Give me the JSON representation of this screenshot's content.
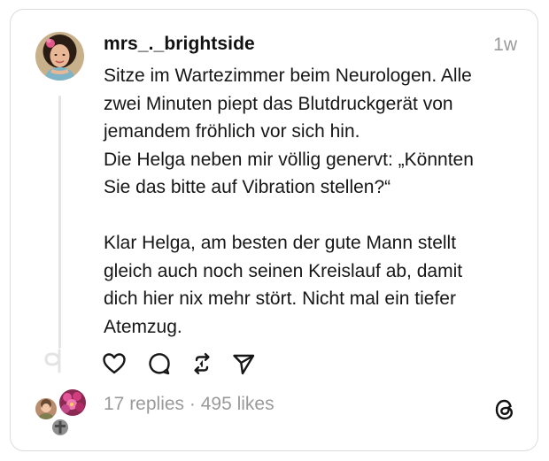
{
  "post": {
    "username": "mrs_._brightside",
    "timestamp": "1w",
    "lines": [
      "Sitze im Wartezimmer beim Neurologen. Alle",
      "zwei Minuten piept das Blutdruckgerät von",
      "jemandem fröhlich vor sich hin.",
      "Die Helga neben mir völlig genervt: „Könnten",
      "Sie das bitte auf Vibration stellen?“",
      "",
      "Klar Helga, am besten der gute Mann stellt",
      "gleich auch noch seinen Kreislauf ab, damit",
      "dich hier nix mehr stört. Nicht mal ein tiefer",
      "Atemzug."
    ]
  },
  "actions": {
    "icons": [
      "heart-icon",
      "comment-icon",
      "repost-icon",
      "share-icon"
    ]
  },
  "stats": {
    "text": "17 replies · 495 likes"
  },
  "icons": {
    "app_logo": "threads-logo-icon",
    "thread_end": "thread-loop-icon"
  },
  "colors": {
    "text": "#161616",
    "muted": "#9a9a9a",
    "border": "#dcdcdc",
    "thread_line": "#e4e4e4"
  }
}
